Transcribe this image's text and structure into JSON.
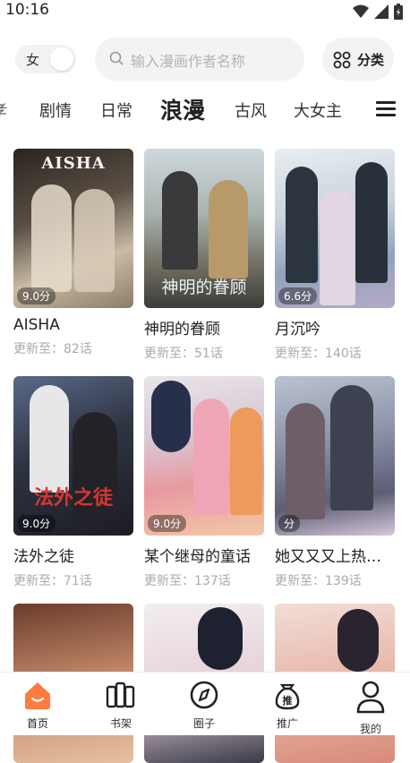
{
  "status_bar": {
    "time": "10:16"
  },
  "header": {
    "gender_label": "女",
    "search_placeholder": "输入漫画作者名称",
    "category_label": "分类"
  },
  "tabs": [
    {
      "label": "孝"
    },
    {
      "label": "剧情"
    },
    {
      "label": "日常"
    },
    {
      "label": "浪漫",
      "active": true
    },
    {
      "label": "古风"
    },
    {
      "label": "大女主"
    }
  ],
  "comics": [
    {
      "title": "AISHA",
      "update": "更新至：82话",
      "score": "9.0分",
      "cover_text": "AISHA"
    },
    {
      "title": "神明的眷顾",
      "update": "更新至：51话",
      "score": "",
      "cover_text": "神明的眷顾"
    },
    {
      "title": "月沉吟",
      "update": "更新至：140话",
      "score": "6.6分",
      "cover_text": ""
    },
    {
      "title": "法外之徒",
      "update": "更新至：71话",
      "score": "9.0分",
      "cover_text": "法外之徒"
    },
    {
      "title": "某个继母的童话",
      "update": "更新至：137话",
      "score": "9.0分",
      "cover_text": ""
    },
    {
      "title": "她又又又上热…",
      "update": "更新至：139话",
      "score": "分",
      "cover_text": ""
    },
    {
      "title": "",
      "update": "",
      "score": "",
      "cover_text": ""
    },
    {
      "title": "",
      "update": "",
      "score": "",
      "cover_text": ""
    },
    {
      "title": "",
      "update": "",
      "score": "",
      "cover_text": ""
    }
  ],
  "bottom_nav": [
    {
      "label": "首页",
      "icon": "home-icon",
      "active": true
    },
    {
      "label": "书架",
      "icon": "bookshelf-icon"
    },
    {
      "label": "圈子",
      "icon": "compass-icon"
    },
    {
      "label": "推广",
      "icon": "promote-bag-icon"
    },
    {
      "label": "我的",
      "icon": "profile-icon"
    }
  ],
  "colors": {
    "accent": "#ff7a3d",
    "text": "#222222",
    "muted": "#aaaaaa"
  }
}
